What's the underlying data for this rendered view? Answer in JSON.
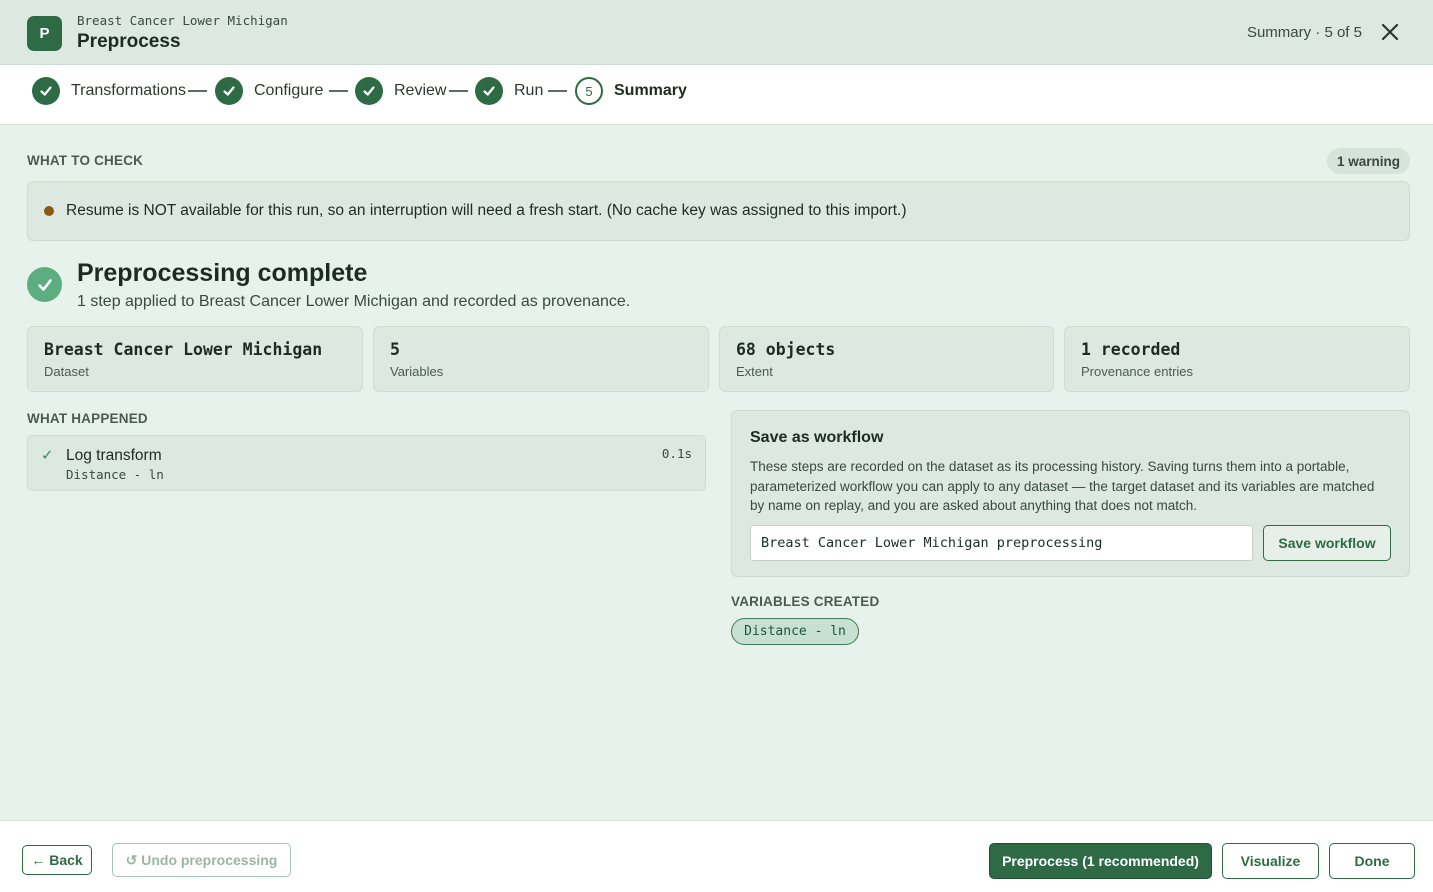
{
  "header": {
    "logo_letter": "P",
    "dataset_name": "Breast Cancer Lower Michigan",
    "title": "Preprocess",
    "step_indicator": "Summary · 5 of 5",
    "close_icon": "close-icon"
  },
  "stepper": {
    "steps": [
      {
        "label": "Transformations",
        "status": "done"
      },
      {
        "label": "Configure",
        "status": "done"
      },
      {
        "label": "Review",
        "status": "done"
      },
      {
        "label": "Run",
        "status": "done"
      },
      {
        "label": "Summary",
        "status": "current",
        "number": "5"
      }
    ]
  },
  "what_to_check": {
    "label": "WHAT TO CHECK",
    "badge": "1 warning",
    "warning_text": "Resume is NOT available for this run, so an interruption will need a fresh start. (No cache key was assigned to this import.)"
  },
  "complete": {
    "title": "Preprocessing complete",
    "subtitle": "1 step applied to Breast Cancer Lower Michigan and recorded as provenance."
  },
  "stats": [
    {
      "value": "Breast Cancer Lower Michigan",
      "label": "Dataset"
    },
    {
      "value": "5",
      "label": "Variables"
    },
    {
      "value": "68 objects",
      "label": "Extent"
    },
    {
      "value": "1 recorded",
      "label": "Provenance entries"
    }
  ],
  "what_happened": {
    "label": "WHAT HAPPENED",
    "items": [
      {
        "name": "Log transform",
        "variable": "Distance - ln",
        "time": "0.1s"
      }
    ]
  },
  "workflow": {
    "title": "Save as workflow",
    "description": "These steps are recorded on the dataset as its processing history. Saving turns them into a portable, parameterized workflow you can apply to any dataset — the target dataset and its variables are matched by name on replay, and you are asked about anything that does not match.",
    "input_value": "Breast Cancer Lower Michigan preprocessing",
    "save_label": "Save workflow"
  },
  "variables_created": {
    "label": "VARIABLES CREATED",
    "items": [
      "Distance - ln"
    ]
  },
  "footer": {
    "back_label": "← Back",
    "undo_label": "↺ Undo preprocessing",
    "preprocess_label": "Preprocess (1 recommended)",
    "visualize_label": "Visualize",
    "done_label": "Done"
  },
  "colors": {
    "accent": "#2e6b45",
    "background": "#e8f2ec",
    "warning_dot": "#8a5a12",
    "success": "#5cae80"
  }
}
